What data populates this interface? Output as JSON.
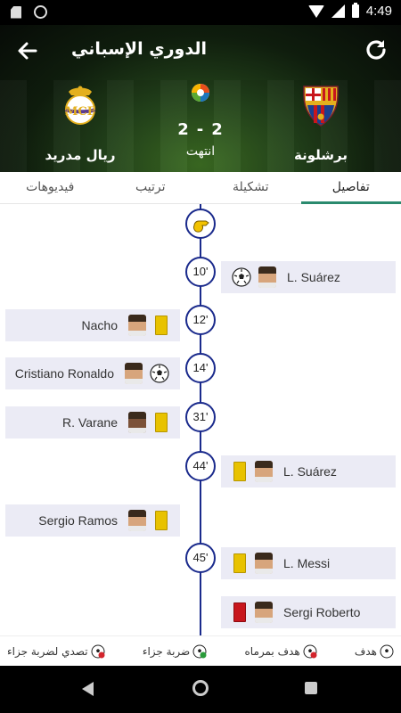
{
  "status_bar": {
    "time": "4:49"
  },
  "header": {
    "title": "الدوري الإسباني"
  },
  "match": {
    "home_team": "برشلونة",
    "away_team": "ريال مدريد",
    "home_score": "2",
    "away_score": "2",
    "separator": "-",
    "status": "انتهت"
  },
  "tabs": [
    {
      "label": "فيديوهات"
    },
    {
      "label": "ترتيب"
    },
    {
      "label": "تشكيلة"
    },
    {
      "label": "تفاصيل"
    }
  ],
  "timeline": {
    "events": [
      {
        "minute": "10'",
        "side": "right",
        "player": "L. Suárez",
        "type": "goal"
      },
      {
        "minute": "12'",
        "side": "left",
        "player": "Nacho",
        "type": "yellow"
      },
      {
        "minute": "14'",
        "side": "left",
        "player": "Cristiano Ronaldo",
        "type": "goal"
      },
      {
        "minute": "31'",
        "side": "left",
        "player": "R. Varane",
        "type": "yellow"
      },
      {
        "minute": "44'",
        "side": "right",
        "player": "L. Suárez",
        "type": "yellow"
      },
      {
        "minute": "",
        "side": "left",
        "player": "Sergio Ramos",
        "type": "yellow"
      },
      {
        "minute": "45'",
        "side": "right",
        "player": "L. Messi",
        "type": "yellow"
      },
      {
        "minute": "",
        "side": "right",
        "player": "Sergi Roberto",
        "type": "red"
      }
    ]
  },
  "legend": [
    {
      "label": "هدف",
      "icon": "goal-ball-icon"
    },
    {
      "label": "هدف بمرماه",
      "icon": "own-goal-ball-icon"
    },
    {
      "label": "ضربة جزاء",
      "icon": "penalty-ball-icon"
    },
    {
      "label": "تصدي لضربة جزاء",
      "icon": "penalty-saved-ball-icon"
    }
  ],
  "colors": {
    "timeline": "#1a2a8c",
    "active_tab": "#2a8a6e",
    "event_bg": "#ebebf5",
    "yellow_card": "#e8c200",
    "red_card": "#c8161d"
  }
}
